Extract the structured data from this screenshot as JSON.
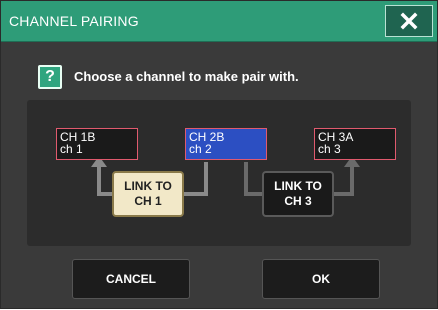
{
  "dialog": {
    "title": "CHANNEL PAIRING",
    "prompt": "Choose a channel to make pair with.",
    "help_icon_glyph": "?",
    "accent_color": "#2e9c78"
  },
  "channels": [
    {
      "name": "CH 1B",
      "sub": "ch 1",
      "selected": false
    },
    {
      "name": "CH 2B",
      "sub": "ch 2",
      "selected": true
    },
    {
      "name": "CH 3A",
      "sub": "ch 3",
      "selected": false
    }
  ],
  "link_buttons": [
    {
      "line1": "LINK TO",
      "line2": "CH  1",
      "active": true
    },
    {
      "line1": "LINK TO",
      "line2": "CH  3",
      "active": false
    }
  ],
  "actions": {
    "cancel_label": "CANCEL",
    "ok_label": "OK"
  },
  "icons": {
    "close": "close-icon",
    "help": "help-icon",
    "connector_arrow": "arrow-up-icon"
  }
}
